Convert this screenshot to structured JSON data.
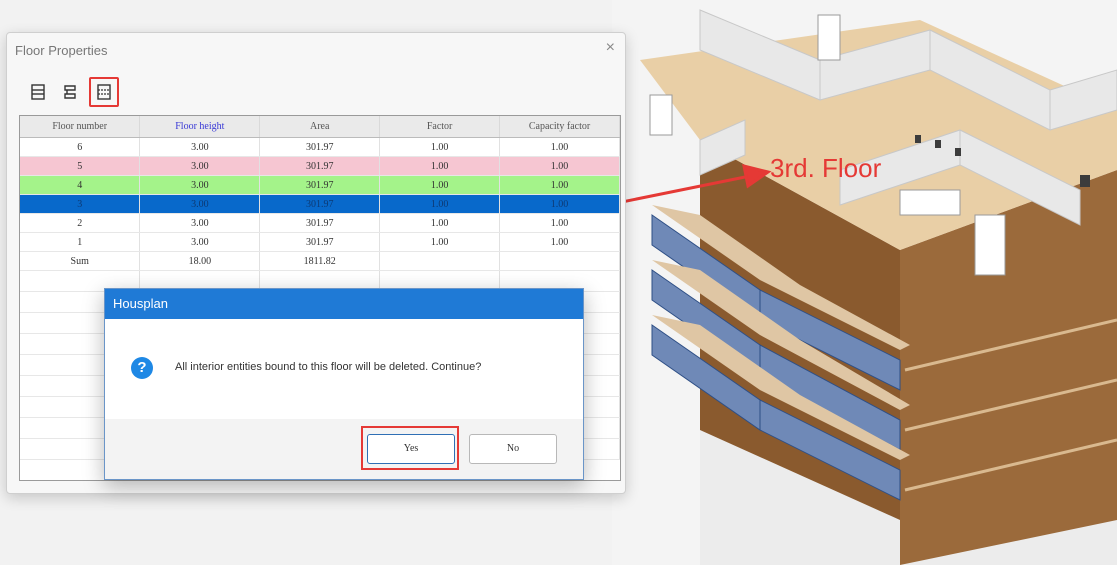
{
  "floor_window": {
    "title": "Floor Properties",
    "close_symbol": "×",
    "toolbar": [
      {
        "icon": "insert-floor-icon",
        "active": false
      },
      {
        "icon": "add-floor-icon",
        "active": false
      },
      {
        "icon": "delete-floor-icon",
        "active": true
      }
    ],
    "columns": [
      "Floor number",
      "Floor height",
      "Area",
      "Factor",
      "Capacity factor"
    ],
    "rows": [
      {
        "floor": "6",
        "height": "3.00",
        "area": "301.97",
        "factor": "1.00",
        "capacity": "1.00",
        "style": ""
      },
      {
        "floor": "5",
        "height": "3.00",
        "area": "301.97",
        "factor": "1.00",
        "capacity": "1.00",
        "style": "pink"
      },
      {
        "floor": "4",
        "height": "3.00",
        "area": "301.97",
        "factor": "1.00",
        "capacity": "1.00",
        "style": "green"
      },
      {
        "floor": "3",
        "height": "3.00",
        "area": "301.97",
        "factor": "1.00",
        "capacity": "1.00",
        "style": "blue"
      },
      {
        "floor": "2",
        "height": "3.00",
        "area": "301.97",
        "factor": "1.00",
        "capacity": "1.00",
        "style": ""
      },
      {
        "floor": "1",
        "height": "3.00",
        "area": "301.97",
        "factor": "1.00",
        "capacity": "1.00",
        "style": ""
      },
      {
        "floor": "Sum",
        "height": "18.00",
        "area": "1811.82",
        "factor": "",
        "capacity": "",
        "style": ""
      }
    ]
  },
  "dialog": {
    "title": "Housplan",
    "message": "All interior entities bound to this floor will be deleted. Continue?",
    "yes_label": "Yes",
    "no_label": "No"
  },
  "annotation": {
    "label": "3rd. Floor",
    "color": "#e53935"
  },
  "colors": {
    "highlight_red": "#e53935",
    "selected_row": "#0869cb",
    "pink_row": "#f6c6d2",
    "green_row": "#a4f38a",
    "dialog_title": "#1f7ad6"
  }
}
